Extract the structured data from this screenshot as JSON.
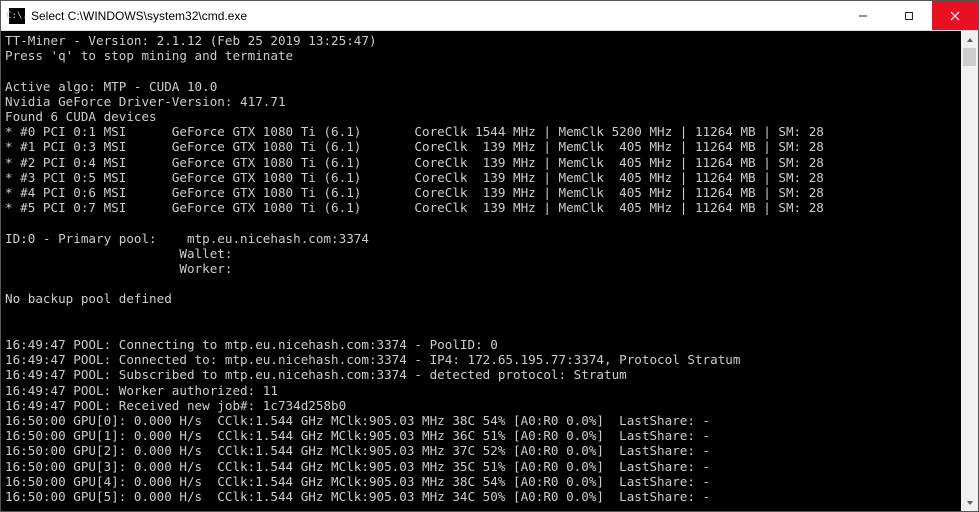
{
  "window": {
    "icon_text": "C:\\.",
    "title": "Select C:\\WINDOWS\\system32\\cmd.exe"
  },
  "miner": {
    "name": "TT-Miner",
    "version": "2.1.12",
    "build_date": "Feb 25 2019 13:25:47",
    "instruction_line": "Press 'q' to stop mining and terminate",
    "active_algo": "MTP - CUDA 10.0",
    "driver_line": "Nvidia GeForce Driver-Version: 417.71",
    "found_line": "Found 6 CUDA devices"
  },
  "devices": [
    {
      "idx": 0,
      "pci": "0:1",
      "vendor": "MSI",
      "model": "GeForce GTX 1080 Ti (6.1)",
      "coreclk": "1544 MHz",
      "memclk": "5200 MHz",
      "mem": "11264 MB",
      "sm": 28
    },
    {
      "idx": 1,
      "pci": "0:3",
      "vendor": "MSI",
      "model": "GeForce GTX 1080 Ti (6.1)",
      "coreclk": "139 MHz",
      "memclk": "405 MHz",
      "mem": "11264 MB",
      "sm": 28
    },
    {
      "idx": 2,
      "pci": "0:4",
      "vendor": "MSI",
      "model": "GeForce GTX 1080 Ti (6.1)",
      "coreclk": "139 MHz",
      "memclk": "405 MHz",
      "mem": "11264 MB",
      "sm": 28
    },
    {
      "idx": 3,
      "pci": "0:5",
      "vendor": "MSI",
      "model": "GeForce GTX 1080 Ti (6.1)",
      "coreclk": "139 MHz",
      "memclk": "405 MHz",
      "mem": "11264 MB",
      "sm": 28
    },
    {
      "idx": 4,
      "pci": "0:6",
      "vendor": "MSI",
      "model": "GeForce GTX 1080 Ti (6.1)",
      "coreclk": "139 MHz",
      "memclk": "405 MHz",
      "mem": "11264 MB",
      "sm": 28
    },
    {
      "idx": 5,
      "pci": "0:7",
      "vendor": "MSI",
      "model": "GeForce GTX 1080 Ti (6.1)",
      "coreclk": "139 MHz",
      "memclk": "405 MHz",
      "mem": "11264 MB",
      "sm": 28
    }
  ],
  "pool": {
    "id": 0,
    "label": "Primary pool",
    "host": "mtp.eu.nicehash.com:3374",
    "wallet_label": "Wallet:",
    "worker_label": "Worker:",
    "no_backup": "No backup pool defined"
  },
  "log": {
    "connecting": "16:49:47 POOL: Connecting to mtp.eu.nicehash.com:3374 - PoolID: 0",
    "connected": "16:49:47 POOL: Connected to: mtp.eu.nicehash.com:3374 - IP4: 172.65.195.77:3374, Protocol Stratum",
    "subscribed": "16:49:47 POOL: Subscribed to mtp.eu.nicehash.com:3374 - detected protocol: Stratum",
    "authorized": "16:49:47 POOL: Worker authorized: 11",
    "job": "16:49:47 POOL: Received new job#: 1c734d258b0"
  },
  "gpu_stats": [
    {
      "ts": "16:50:00",
      "idx": 0,
      "rate": "0.000 H/s",
      "cclk": "1.544 GHz",
      "mclk": "905.03 MHz",
      "temp": "38C",
      "fan": "54%",
      "ar": "[A0:R0 0.0%]",
      "last": "LastShare: -"
    },
    {
      "ts": "16:50:00",
      "idx": 1,
      "rate": "0.000 H/s",
      "cclk": "1.544 GHz",
      "mclk": "905.03 MHz",
      "temp": "36C",
      "fan": "51%",
      "ar": "[A0:R0 0.0%]",
      "last": "LastShare: -"
    },
    {
      "ts": "16:50:00",
      "idx": 2,
      "rate": "0.000 H/s",
      "cclk": "1.544 GHz",
      "mclk": "905.03 MHz",
      "temp": "37C",
      "fan": "52%",
      "ar": "[A0:R0 0.0%]",
      "last": "LastShare: -"
    },
    {
      "ts": "16:50:00",
      "idx": 3,
      "rate": "0.000 H/s",
      "cclk": "1.544 GHz",
      "mclk": "905.03 MHz",
      "temp": "35C",
      "fan": "51%",
      "ar": "[A0:R0 0.0%]",
      "last": "LastShare: -"
    },
    {
      "ts": "16:50:00",
      "idx": 4,
      "rate": "0.000 H/s",
      "cclk": "1.544 GHz",
      "mclk": "905.03 MHz",
      "temp": "38C",
      "fan": "54%",
      "ar": "[A0:R0 0.0%]",
      "last": "LastShare: -"
    },
    {
      "ts": "16:50:00",
      "idx": 5,
      "rate": "0.000 H/s",
      "cclk": "1.544 GHz",
      "mclk": "905.03 MHz",
      "temp": "34C",
      "fan": "50%",
      "ar": "[A0:R0 0.0%]",
      "last": "LastShare: -"
    }
  ]
}
